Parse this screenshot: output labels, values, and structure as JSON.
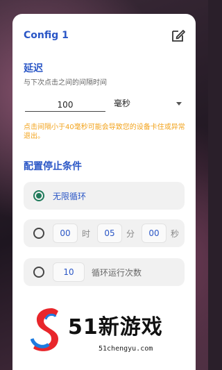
{
  "dialog": {
    "title": "Config 1"
  },
  "delay": {
    "heading": "延迟",
    "subtitle": "与下次点击之间的间隔时间",
    "value": "100",
    "unit": "毫秒",
    "warning": "点击间隔小于40毫秒可能会导致您的设备卡住或异常退出。"
  },
  "stop": {
    "heading": "配置停止条件",
    "infinite_label": "无限循环",
    "timer": {
      "hours": "00",
      "hours_unit": "时",
      "minutes": "05",
      "minutes_unit": "分",
      "seconds": "00",
      "seconds_unit": "秒"
    },
    "count": {
      "value": "10",
      "label": "循环运行次数"
    }
  },
  "watermark": {
    "text": "51新游戏",
    "url": "51chengyu.com"
  },
  "colors": {
    "accent": "#2a56c6",
    "radio_checked": "#1f7a5a",
    "warning": "#f2a31c"
  }
}
